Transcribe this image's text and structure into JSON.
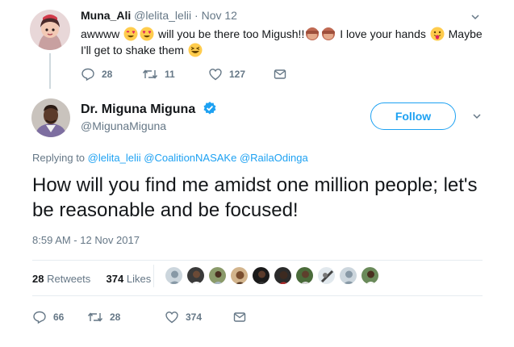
{
  "reply": {
    "name": "Muna_Ali",
    "handle": "@lelita_lelii",
    "date": "Nov 12",
    "text_1": "awwww",
    "text_2": "will you be there too Migush!!",
    "text_3": "I love your hands",
    "text_4": "Maybe",
    "text_5": "I'll get to shake them",
    "actions": {
      "replies": "28",
      "retweets": "11",
      "likes": "127"
    }
  },
  "tweet": {
    "name": "Dr. Miguna Miguna",
    "handle": "@MigunaMiguna",
    "follow_label": "Follow",
    "replying_prefix": "Replying to",
    "replying_to": [
      "@lelita_lelii",
      "@CoalitionNASAKe",
      "@RailaOdinga"
    ],
    "text": "How will you find me amidst one million people; let's be reasonable and be focused!",
    "timestamp": "8:59 AM - 12 Nov 2017",
    "retweets_count": "28",
    "retweets_label": "Retweets",
    "likes_count": "374",
    "likes_label": "Likes",
    "actions": {
      "replies": "66",
      "retweets": "28",
      "likes": "374"
    }
  },
  "icons": {
    "reply_icon": "reply-icon",
    "retweet_icon": "retweet-icon",
    "like_icon": "heart-icon",
    "dm_icon": "envelope-icon",
    "verified_icon": "verified-badge-icon"
  },
  "colors": {
    "accent": "#1da1f2",
    "muted": "#657786",
    "text": "#14171a",
    "divider": "#e6ecf0"
  }
}
